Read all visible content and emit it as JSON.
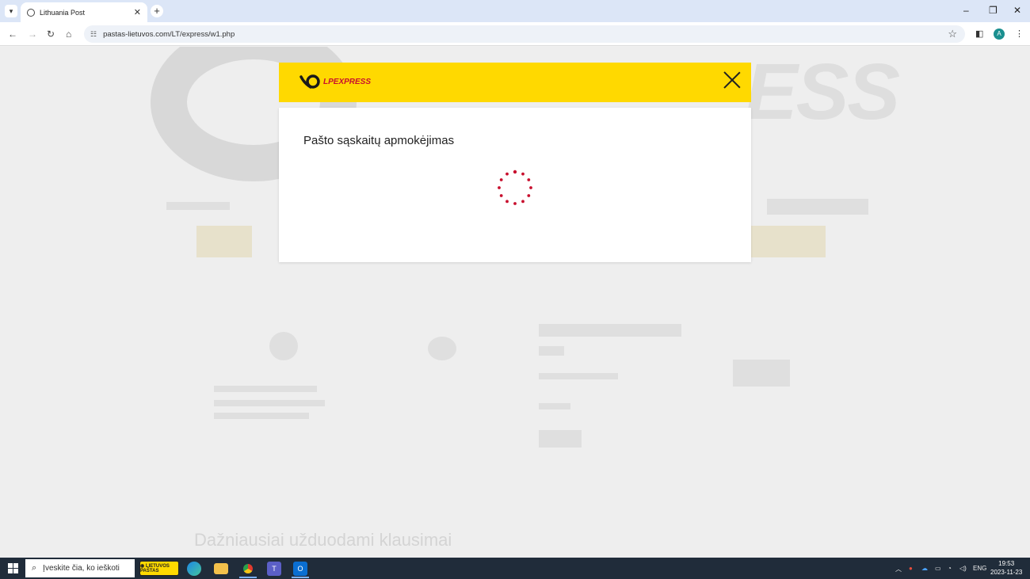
{
  "browser": {
    "tab_title": "Lithuania Post",
    "url": "pastas-lietuvos.com/LT/express/w1.php",
    "avatar_initial": "A"
  },
  "modal": {
    "logo_text": "LPEXPRESS",
    "title": "Pašto sąskaitų apmokėjimas",
    "brand_color": "#ffd900",
    "spinner_color": "#c8102e"
  },
  "taskbar": {
    "search_placeholder": "Įveskite čia, ko ieškoti",
    "lang": "ENG",
    "time": "19:53",
    "date": "2023-11-23"
  },
  "icons": [
    "dropdown-icon",
    "globe-icon",
    "close-icon",
    "plus-icon",
    "minimize-icon",
    "restore-icon",
    "back-icon",
    "forward-icon",
    "reload-icon",
    "home-icon",
    "site-settings-icon",
    "star-icon",
    "sidepanel-icon",
    "menu-icon",
    "windows-icon",
    "search-icon",
    "edge-icon",
    "folder-icon",
    "chrome-icon",
    "teams-icon",
    "outlook-icon"
  ]
}
